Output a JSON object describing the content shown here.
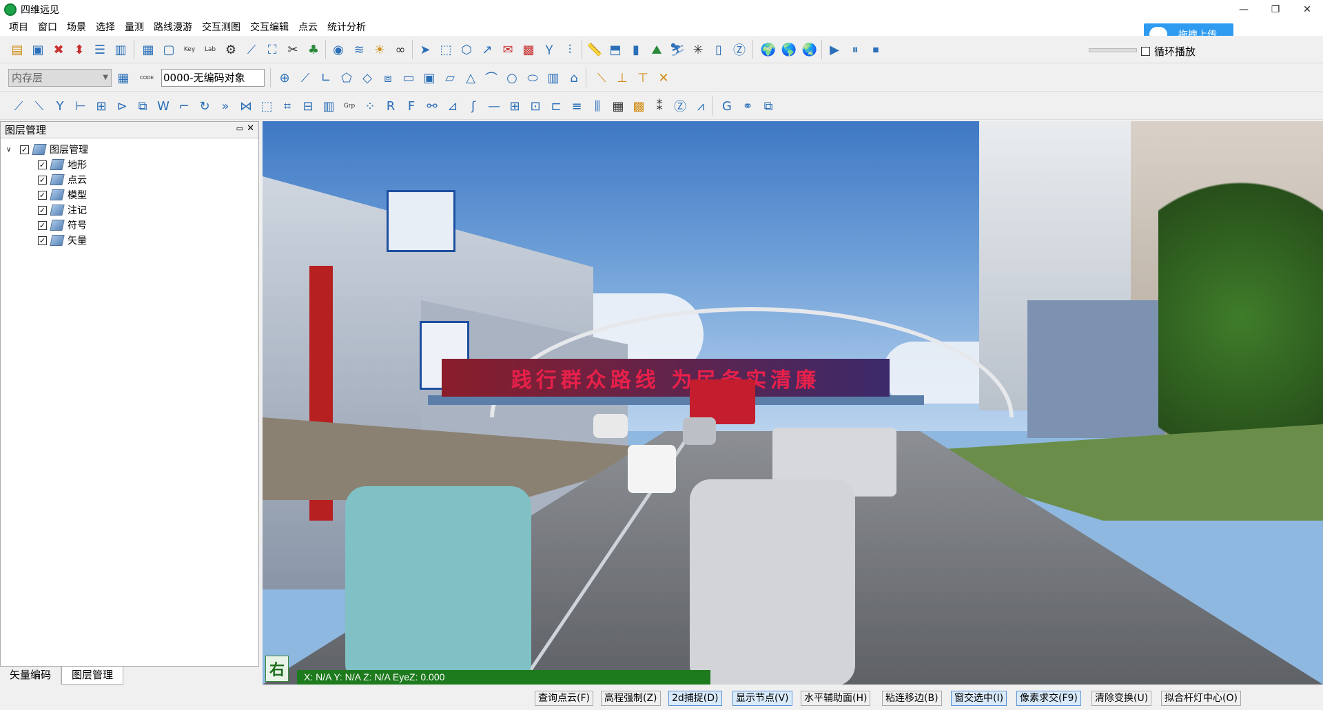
{
  "app": {
    "title": "四维远见"
  },
  "window_controls": {
    "minimize": "—",
    "restore": "❐",
    "close": "✕"
  },
  "menu": [
    "项目",
    "窗口",
    "场景",
    "选择",
    "量测",
    "路线漫游",
    "交互测图",
    "交互编辑",
    "点云",
    "统计分析"
  ],
  "upload": {
    "label": "拖拽上传"
  },
  "loop_play": {
    "label": "循环播放",
    "checked": false
  },
  "layer_combo": {
    "value": "内存层"
  },
  "code_field": {
    "value": "0000-无编码对象"
  },
  "layer_panel": {
    "title": "图层管理",
    "root": {
      "label": "图层管理",
      "checked": true,
      "expanded": true
    },
    "items": [
      {
        "label": "地形",
        "checked": true
      },
      {
        "label": "点云",
        "checked": true
      },
      {
        "label": "模型",
        "checked": true
      },
      {
        "label": "注记",
        "checked": true
      },
      {
        "label": "符号",
        "checked": true
      },
      {
        "label": "矢量",
        "checked": true
      }
    ]
  },
  "bottom_tabs": [
    "矢量编码",
    "图层管理"
  ],
  "viewport": {
    "compass": "右",
    "coords": "X: N/A Y: N/A Z: N/A EyeZ: 0.000",
    "banner": "践行群众路线 为民务实清廉"
  },
  "status_buttons": [
    {
      "label": "查询点云(F)",
      "active": false
    },
    {
      "label": "高程强制(Z)",
      "active": false
    },
    {
      "label": "2d捕捉(D)",
      "active": true
    },
    {
      "label": "显示节点(V)",
      "active": true
    },
    {
      "label": "水平辅助面(H)",
      "active": false
    },
    {
      "label": "粘连移边(B)",
      "active": false
    },
    {
      "label": "窗交选中(I)",
      "active": true
    },
    {
      "label": "像素求交(F9)",
      "active": true
    },
    {
      "label": "清除变换(U)",
      "active": false
    },
    {
      "label": "拟合杆灯中心(O)",
      "active": false
    }
  ]
}
